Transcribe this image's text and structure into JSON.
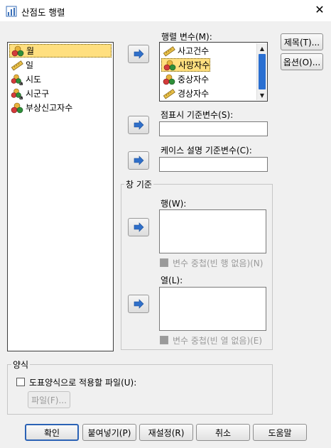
{
  "window": {
    "title": "산점도 행렬",
    "close_glyph": "✕"
  },
  "source_list": {
    "items": [
      {
        "label": "월",
        "icon": "nominal-icon",
        "selected": true
      },
      {
        "label": "일",
        "icon": "scale-ruler-icon",
        "selected": false
      },
      {
        "label": "시도",
        "icon": "nominal-string-icon",
        "selected": false
      },
      {
        "label": "시군구",
        "icon": "nominal-string-icon",
        "selected": false
      },
      {
        "label": "부상신고자수",
        "icon": "nominal-icon",
        "selected": false
      }
    ]
  },
  "matrix_variables": {
    "label": "행렬 변수(M):",
    "items": [
      {
        "label": "사고건수",
        "icon": "scale-ruler-icon",
        "selected": false
      },
      {
        "label": "사망자수",
        "icon": "nominal-icon",
        "selected": true
      },
      {
        "label": "중상자수",
        "icon": "nominal-icon",
        "selected": false
      },
      {
        "label": "경상자수",
        "icon": "scale-ruler-icon",
        "selected": false
      }
    ]
  },
  "marker_variable": {
    "label": "점표시 기준변수(S):",
    "value": ""
  },
  "case_label_variable": {
    "label": "케이스 설명 기준변수(C):",
    "value": ""
  },
  "panel_group": {
    "title": "창 기준",
    "rows": {
      "label": "행(W):",
      "nest_label": "변수 중첩(빈 행 없음)(N)"
    },
    "columns": {
      "label": "열(L):",
      "nest_label": "변수 중첩(빈 열 없음)(E)"
    }
  },
  "template_group": {
    "title": "양식",
    "checkbox_label": "도표양식으로 적용할 파일(U):",
    "file_button": "파일(F)..."
  },
  "side_buttons": {
    "titles": "제목(T)...",
    "options": "옵션(O)..."
  },
  "footer": {
    "ok": "확인",
    "paste": "붙여넣기(P)",
    "reset": "재설정(R)",
    "cancel": "취소",
    "help": "도움말"
  },
  "colors": {
    "selection": "#ffdf7f",
    "scroll_thumb": "#2a6fd1",
    "arrow_blue": "#2f6fc9",
    "default_button_border": "#2b62b5"
  }
}
